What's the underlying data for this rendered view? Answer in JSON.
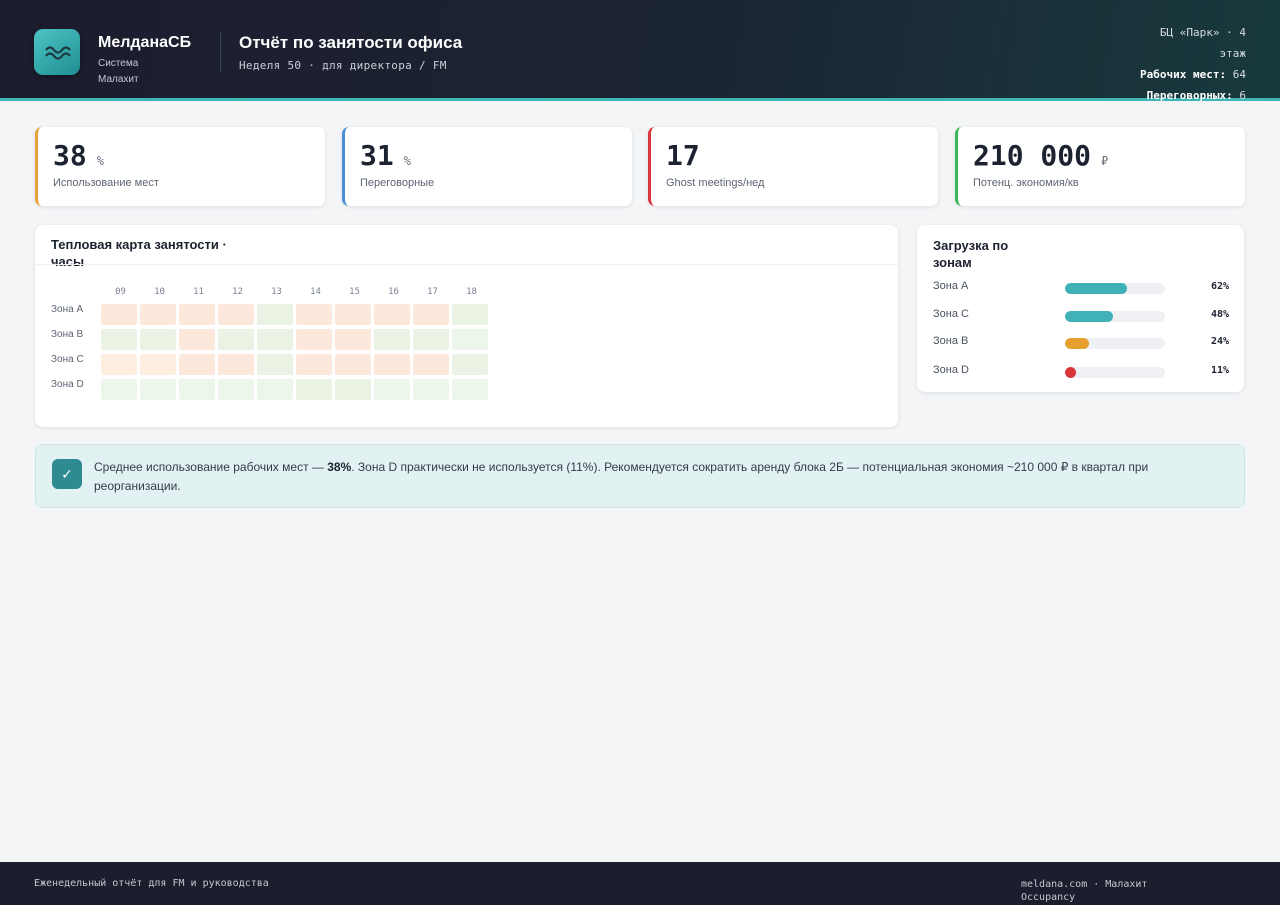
{
  "header": {
    "brand": "МелданаСБ",
    "brand_sub": "Система Малахит",
    "title": "Отчёт по занятости офиса",
    "subtitle": "Неделя 50 · для директора / FM",
    "location": "БЦ «Парк» · 4 этаж",
    "desks_label": "Рабочих мест:",
    "desks_value": "64",
    "rooms_label": "Переговорных:",
    "rooms_value": "6"
  },
  "kpis": [
    {
      "value": "38",
      "unit": "%",
      "label": "Использование мест",
      "color": "#e6a33a"
    },
    {
      "value": "31",
      "unit": "%",
      "label": "Переговорные",
      "color": "#4a8fd8"
    },
    {
      "value": "17",
      "unit": "",
      "label": "Ghost meetings/нед",
      "color": "#d8363a"
    },
    {
      "value": "210 000",
      "unit": "₽",
      "label": "Потенц. экономия/кв",
      "color": "#3cb85a"
    }
  ],
  "heatmap": {
    "title": "Тепловая карта занятости · часы",
    "hours": [
      "09",
      "10",
      "11",
      "12",
      "13",
      "14",
      "15",
      "16",
      "17",
      "18"
    ],
    "zones": [
      "Зона A",
      "Зона B",
      "Зона C",
      "Зона D"
    ],
    "levels": [
      [
        1,
        1,
        1,
        1,
        2,
        1,
        1,
        1,
        1,
        2
      ],
      [
        2,
        2,
        1,
        2,
        2,
        1,
        1,
        2,
        2,
        4
      ],
      [
        3,
        3,
        1,
        1,
        2,
        1,
        1,
        1,
        1,
        2
      ],
      [
        4,
        4,
        4,
        4,
        4,
        2,
        2,
        4,
        4,
        4
      ]
    ]
  },
  "zone_load": {
    "title": "Загрузка по зонам",
    "rows": [
      {
        "name": "Зона A",
        "percent": 62,
        "label": "62%",
        "color": "#3fb2b8"
      },
      {
        "name": "Зона C",
        "percent": 48,
        "label": "48%",
        "color": "#3fb2b8"
      },
      {
        "name": "Зона B",
        "percent": 24,
        "label": "24%",
        "color": "#e6a02e"
      },
      {
        "name": "Зона D",
        "percent": 11,
        "label": "11%",
        "color": "#d8363a"
      }
    ]
  },
  "insight": {
    "pre": "Среднее использование рабочих мест — ",
    "bold": "38%",
    "post": ". Зона D практически не используется (11%). Рекомендуется сократить аренду блока 2Б — потенциальная экономия ~210 000 ₽ в квартал при реорганизации."
  },
  "footer": {
    "left": "Еженедельный отчёт для FM и руководства",
    "right": "meldana.com · Малахит Occupancy"
  }
}
